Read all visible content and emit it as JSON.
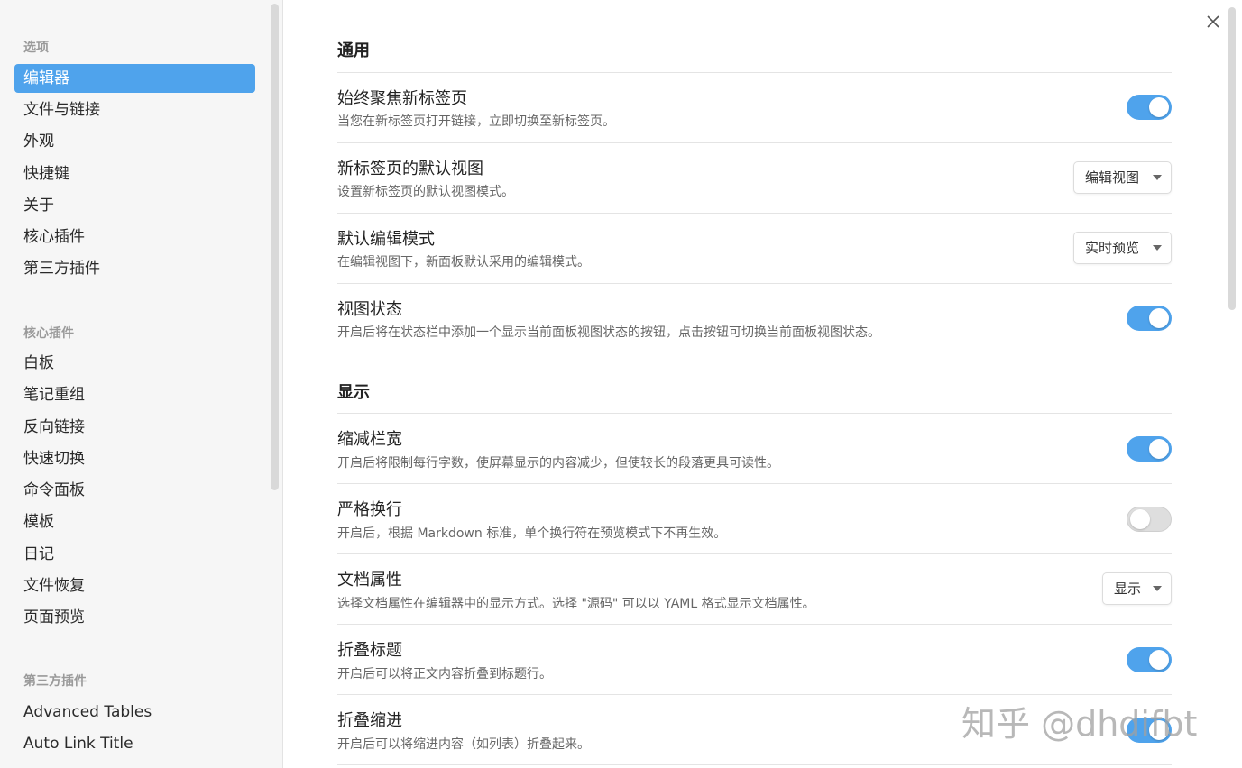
{
  "sidebar": {
    "heading_options": "选项",
    "options": [
      "编辑器",
      "文件与链接",
      "外观",
      "快捷键",
      "关于",
      "核心插件",
      "第三方插件"
    ],
    "heading_core": "核心插件",
    "core_plugins": [
      "白板",
      "笔记重组",
      "反向链接",
      "快速切换",
      "命令面板",
      "模板",
      "日记",
      "文件恢复",
      "页面预览"
    ],
    "heading_third": "第三方插件",
    "third_plugins": [
      "Advanced Tables",
      "Auto Link Title"
    ]
  },
  "close_icon": "close-icon",
  "sections": {
    "general": "通用",
    "display": "显示"
  },
  "settings": [
    {
      "name": "始终聚焦新标签页",
      "desc": "当您在新标签页打开链接，立即切换至新标签页。",
      "control": "toggle",
      "on": true
    },
    {
      "name": "新标签页的默认视图",
      "desc": "设置新标签页的默认视图模式。",
      "control": "dropdown",
      "value": "编辑视图"
    },
    {
      "name": "默认编辑模式",
      "desc": "在编辑视图下，新面板默认采用的编辑模式。",
      "control": "dropdown",
      "value": "实时预览"
    },
    {
      "name": "视图状态",
      "desc": "开启后将在状态栏中添加一个显示当前面板视图状态的按钮，点击按钮可切换当前面板视图状态。",
      "control": "toggle",
      "on": true
    },
    {
      "name": "缩减栏宽",
      "desc": "开启后将限制每行字数，使屏幕显示的内容减少，但使较长的段落更具可读性。",
      "control": "toggle",
      "on": true
    },
    {
      "name": "严格换行",
      "desc": "开启后，根据 Markdown 标准，单个换行符在预览模式下不再生效。",
      "control": "toggle",
      "on": false
    },
    {
      "name": "文档属性",
      "desc": "选择文档属性在编辑器中的显示方式。选择 \"源码\" 可以以 YAML 格式显示文档属性。",
      "control": "dropdown",
      "value": "显示"
    },
    {
      "name": "折叠标题",
      "desc": "开启后可以将正文内容折叠到标题行。",
      "control": "toggle",
      "on": true
    },
    {
      "name": "折叠缩进",
      "desc": "开启后可以将缩进内容（如列表）折叠起来。",
      "control": "toggle",
      "on": true
    }
  ],
  "watermark": "知乎 @dhdifbt",
  "colors": {
    "accent": "#4fa3ec",
    "toggle_off": "#dedede"
  }
}
